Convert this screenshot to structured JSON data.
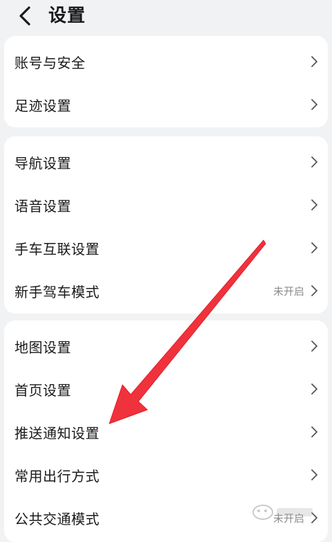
{
  "header": {
    "title": "设置"
  },
  "groups": [
    {
      "items": [
        {
          "label": "账号与安全",
          "value": ""
        },
        {
          "label": "足迹设置",
          "value": ""
        }
      ]
    },
    {
      "items": [
        {
          "label": "导航设置",
          "value": ""
        },
        {
          "label": "语音设置",
          "value": ""
        },
        {
          "label": "手车互联设置",
          "value": ""
        },
        {
          "label": "新手驾车模式",
          "value": "未开启"
        }
      ]
    },
    {
      "items": [
        {
          "label": "地图设置",
          "value": ""
        },
        {
          "label": "首页设置",
          "value": ""
        },
        {
          "label": "推送通知设置",
          "value": ""
        },
        {
          "label": "常用出行方式",
          "value": ""
        },
        {
          "label": "公共交通模式",
          "value": "未开启"
        }
      ]
    }
  ],
  "annotation": {
    "arrow_color": "#f0323c"
  },
  "icons": {
    "back": "chevron-left-icon",
    "row_chevron": "chevron-right-icon"
  }
}
